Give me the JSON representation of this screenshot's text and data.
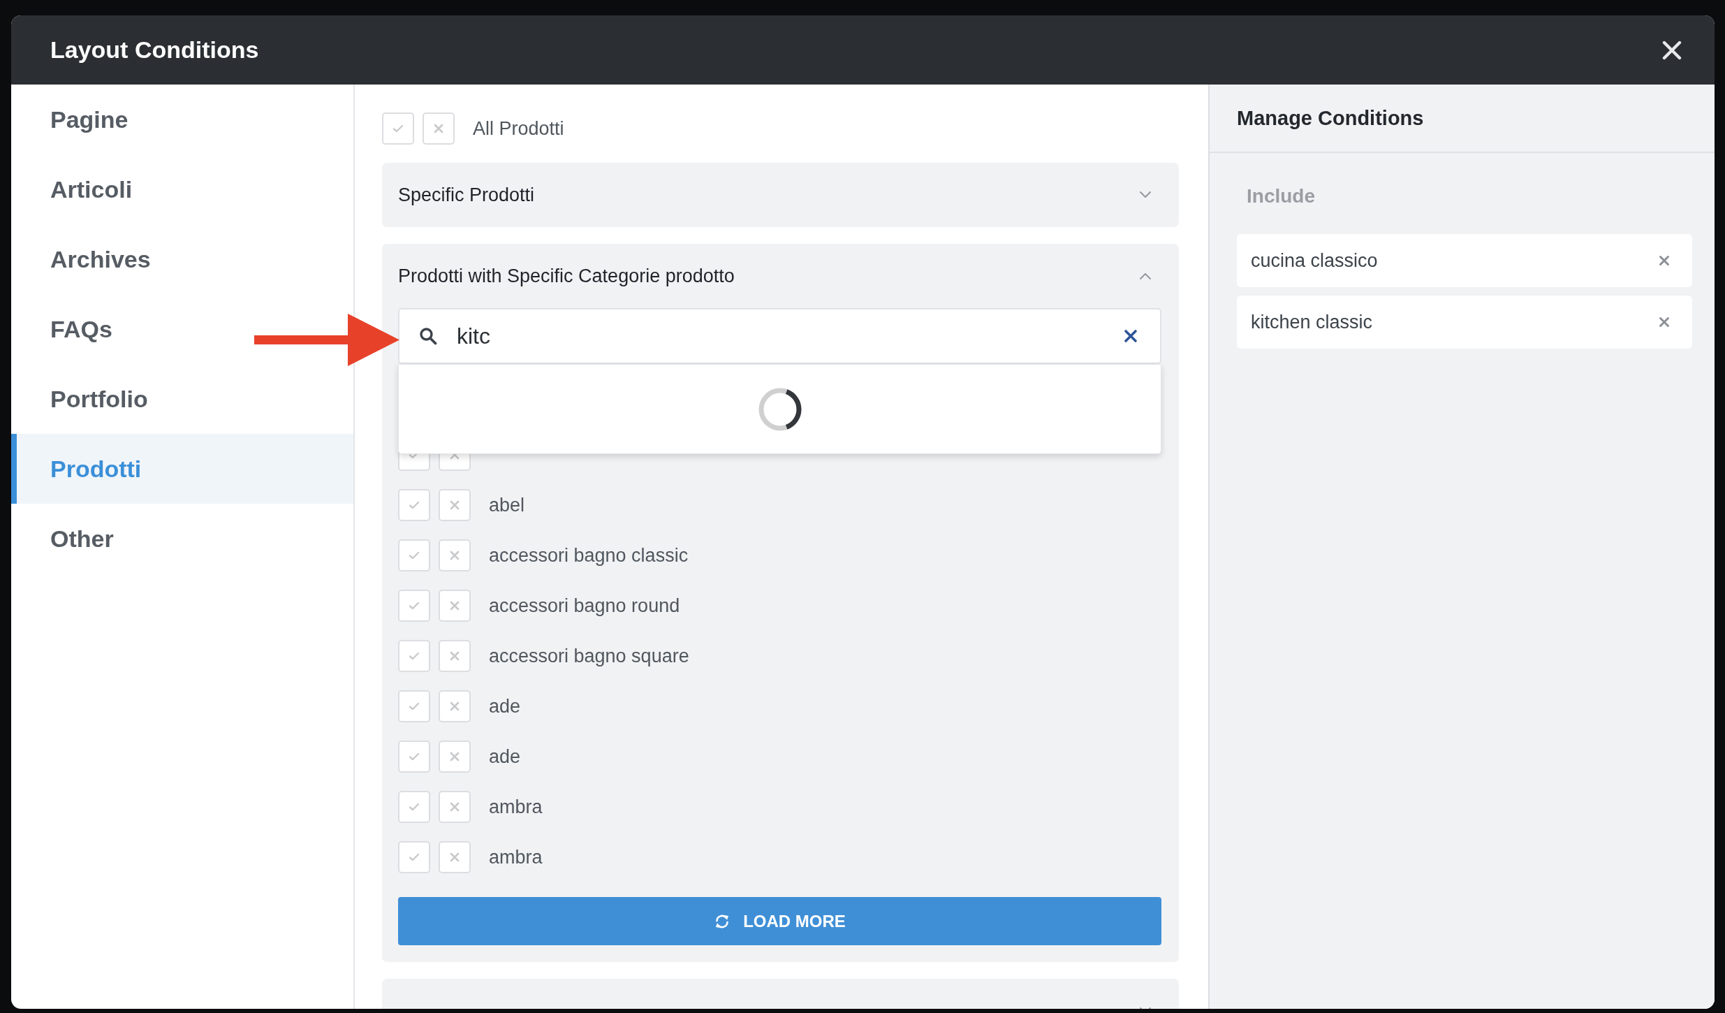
{
  "dialog": {
    "title": "Layout Conditions"
  },
  "sidebar": {
    "items": [
      {
        "label": "Pagine",
        "selected": false
      },
      {
        "label": "Articoli",
        "selected": false
      },
      {
        "label": "Archives",
        "selected": false
      },
      {
        "label": "FAQs",
        "selected": false
      },
      {
        "label": "Portfolio",
        "selected": false
      },
      {
        "label": "Prodotti",
        "selected": true
      },
      {
        "label": "Other",
        "selected": false
      }
    ]
  },
  "conditions": {
    "all_option": {
      "label": "All Prodotti",
      "included": false,
      "excluded": false
    },
    "sections": [
      {
        "title": "Specific Prodotti",
        "expanded": false
      },
      {
        "title": "Prodotti with Specific Categorie prodotto",
        "expanded": true,
        "search": {
          "value": "kitc",
          "loading": true
        },
        "items": [
          {
            "included": false,
            "excluded": false
          },
          {
            "label": "abel",
            "included": false,
            "excluded": false
          },
          {
            "label": "accessori bagno classic",
            "included": false,
            "excluded": false
          },
          {
            "label": "accessori bagno round",
            "included": false,
            "excluded": false
          },
          {
            "label": "accessori bagno square",
            "included": false,
            "excluded": false
          },
          {
            "label": "ade",
            "included": false,
            "excluded": false
          },
          {
            "label": "ade",
            "included": false,
            "excluded": false
          },
          {
            "label": "ambra",
            "included": false,
            "excluded": false
          },
          {
            "label": "ambra",
            "included": false,
            "excluded": false
          }
        ],
        "load_more": "LOAD MORE"
      },
      {
        "expanded": false
      }
    ]
  },
  "manage_panel": {
    "title": "Manage Conditions",
    "include_heading": "Include",
    "included_items": [
      "cucina classico",
      "kitchen classic"
    ]
  }
}
